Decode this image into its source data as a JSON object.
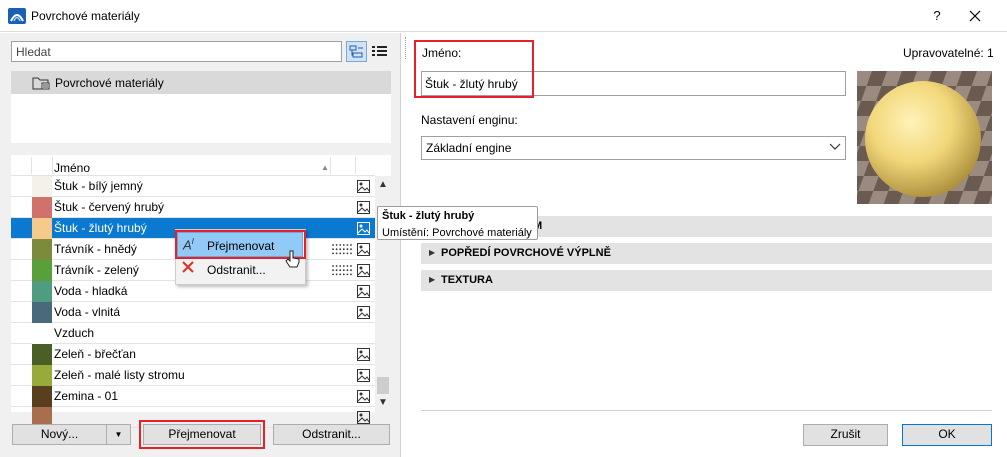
{
  "window": {
    "title": "Povrchové materiály",
    "help": "?",
    "close": "✕"
  },
  "search": {
    "placeholder": "Hledat",
    "value": ""
  },
  "folder": {
    "label": "Povrchové materiály"
  },
  "list": {
    "header": "Jméno",
    "rows": [
      {
        "name": "Štuk - bílý jemný",
        "color": "#f3f1ea",
        "selected": false
      },
      {
        "name": "Štuk - červený hrubý",
        "color": "#d0716b",
        "selected": false
      },
      {
        "name": "Štuk - žlutý hrubý",
        "color": "#f6c98d",
        "selected": true
      },
      {
        "name": "Trávník - hnědý",
        "color": "#7b8a3b",
        "selected": false
      },
      {
        "name": "Trávník - zelený",
        "color": "#5aa03a",
        "selected": false
      },
      {
        "name": "Voda - hladká",
        "color": "#4f9c80",
        "selected": false
      },
      {
        "name": "Voda - vlnitá",
        "color": "#4a6a7c",
        "selected": false
      },
      {
        "name": "Vzduch",
        "color": "#ffffff",
        "selected": false
      },
      {
        "name": "Zeleň - břečťan",
        "color": "#4a5f28",
        "selected": false
      },
      {
        "name": "Zeleň - malé listy stromu",
        "color": "#98aa3a",
        "selected": false
      },
      {
        "name": "Zemina - 01",
        "color": "#5a3f1e",
        "selected": false
      },
      {
        "name": "",
        "color": "#a86e4e",
        "selected": false
      }
    ]
  },
  "buttons": {
    "new": "Nový...",
    "rename": "Přejmenovat",
    "delete": "Odstranit...",
    "cancel": "Zrušit",
    "ok": "OK"
  },
  "context_menu": {
    "rename": "Přejmenovat",
    "delete": "Odstranit..."
  },
  "tooltip": {
    "title": "Štuk - žlutý hrubý",
    "location": "Umístění: Povrchové materiály"
  },
  "details": {
    "name_label": "Jméno:",
    "editable_label": "Upravovatelné: 1",
    "name_value": "Štuk - žlutý hrubý",
    "engine_label": "Nastavení enginu:",
    "engine_value": "Základní engine",
    "sections": [
      "M",
      "POPŘEDÍ POVRCHOVÉ VÝPLNĚ",
      "TEXTURA"
    ]
  }
}
